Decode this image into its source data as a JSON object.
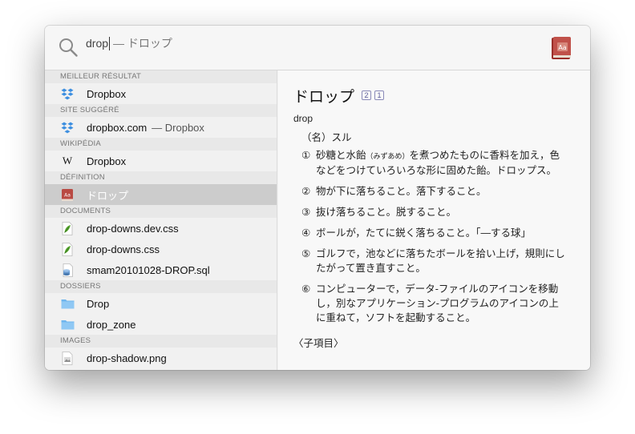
{
  "search": {
    "query": "drop",
    "completion": "— ドロップ"
  },
  "sections": [
    {
      "header": "MEILLEUR RÉSULTAT",
      "items": [
        {
          "icon": "dropbox-icon",
          "label": "Dropbox"
        }
      ]
    },
    {
      "header": "SITE SUGGÉRÉ",
      "items": [
        {
          "icon": "dropbox-icon",
          "label": "dropbox.com",
          "sub": "— Dropbox"
        }
      ]
    },
    {
      "header": "WIKIPÉDIA",
      "items": [
        {
          "icon": "wikipedia-icon",
          "icon_text": "W",
          "label": "Dropbox"
        }
      ]
    },
    {
      "header": "DÉFINITION",
      "items": [
        {
          "icon": "dictionary-icon",
          "icon_text": "Aa",
          "label": "ドロップ",
          "selected": true
        }
      ]
    },
    {
      "header": "DOCUMENTS",
      "items": [
        {
          "icon": "css-file-icon",
          "label": "drop-downs.dev.css"
        },
        {
          "icon": "css-file-icon",
          "label": "drop-downs.css"
        },
        {
          "icon": "sql-file-icon",
          "label": "smam20101028-DROP.sql"
        }
      ]
    },
    {
      "header": "DOSSIERS",
      "items": [
        {
          "icon": "folder-icon",
          "label": "Drop"
        },
        {
          "icon": "folder-icon",
          "label": "drop_zone"
        }
      ]
    },
    {
      "header": "IMAGES",
      "items": [
        {
          "icon": "image-file-icon",
          "label": "drop-shadow.png"
        }
      ]
    }
  ],
  "dict_icon_text": "Aa",
  "preview": {
    "headword": "ドロップ",
    "accents": [
      "2",
      "1"
    ],
    "romaji": "drop",
    "pos": "（名）スル",
    "senses": [
      {
        "num": "①",
        "pre": "砂糖と水飴",
        "note": "（みずあめ）",
        "post": "を煮つめたものに香料を加え，色などをつけていろいろな形に固めた飴。ドロップス。"
      },
      {
        "num": "②",
        "text": "物が下に落ちること。落下すること。"
      },
      {
        "num": "③",
        "text": "抜け落ちること。脱すること。"
      },
      {
        "num": "④",
        "text": "ボールが，たてに鋭く落ちること。「—する球」"
      },
      {
        "num": "⑤",
        "text": "ゴルフで，池などに落ちたボールを拾い上げ，規則にしたがって置き直すこと。"
      },
      {
        "num": "⑥",
        "text": "コンピューターで，データ-ファイルのアイコンを移動し，別なアプリケーション-プログラムのアイコンの上に重ねて，ソフトを起動すること。"
      }
    ],
    "subentries_label": "〈子項目〉"
  },
  "colors": {
    "dropbox": "#3d8fe0",
    "folder": "#6fb6ee",
    "dictionary": "#b94a43",
    "selection": "#cccccc"
  }
}
